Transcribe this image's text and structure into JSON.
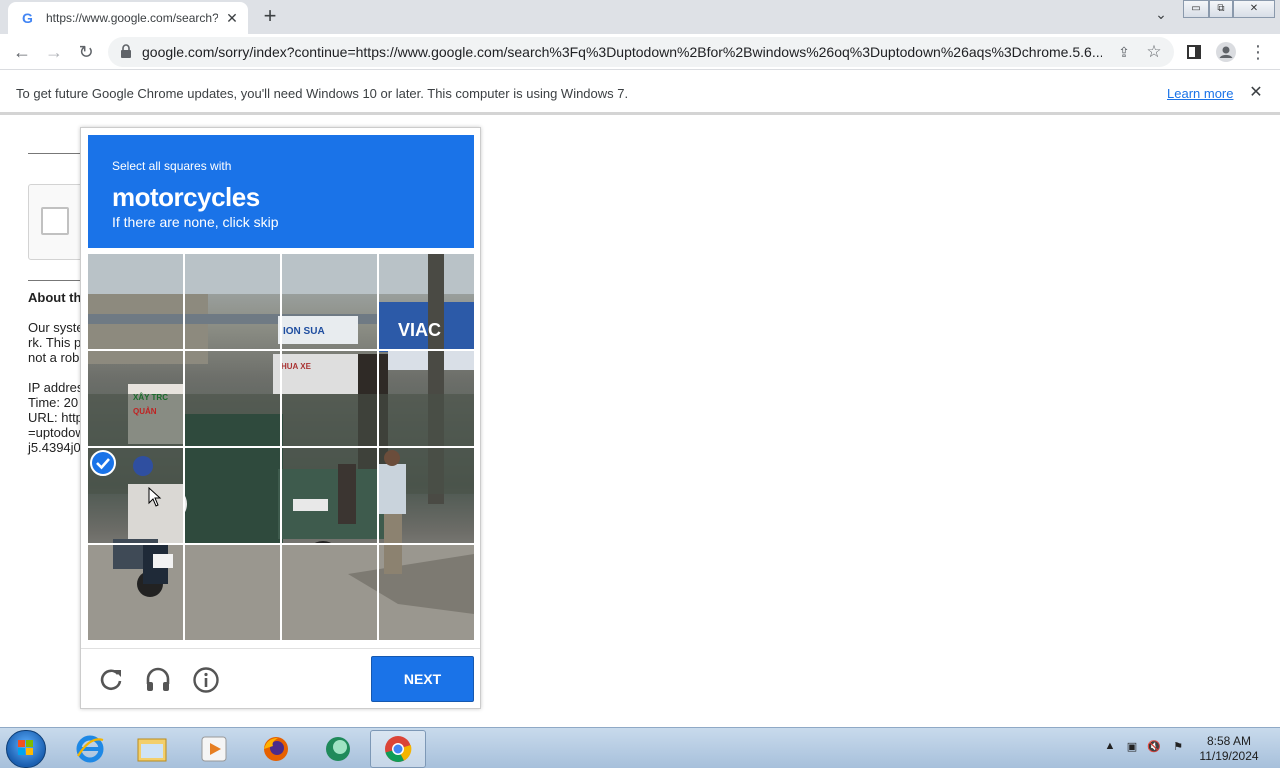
{
  "browser": {
    "tab": {
      "title": "https://www.google.com/search?q",
      "favicon": "google-g-icon"
    },
    "url": "google.com/sorry/index?continue=https://www.google.com/search%3Fq%3Duptodown%2Bfor%2Bwindows%26oq%3Duptodown%26aqs%3Dchrome.5.6...",
    "window_controls": [
      "minimize",
      "restore",
      "close"
    ]
  },
  "infobar": {
    "message": "To get future Google Chrome updates, you'll need Windows 10 or later. This computer is using Windows 7.",
    "link": "Learn more"
  },
  "page": {
    "about_heading": "About th",
    "para1": [
      "Our syste",
      "rk. This p",
      "not a rob"
    ],
    "para2": [
      "IP addres",
      "Time: 20",
      "URL: http",
      "=uptodow",
      "j5.4394j0"
    ]
  },
  "captcha": {
    "instruction": "Select all squares with",
    "target": "motorcycles",
    "hint": "If there are none, click skip",
    "grid": {
      "rows": 4,
      "cols": 4,
      "selected": [
        [
          2,
          0
        ]
      ]
    },
    "sign_texts": [
      "ION SUA",
      "VIAC",
      "HUA XE",
      "XÂY TRC",
      "QUẢN"
    ],
    "next_label": "NEXT",
    "footer_icons": [
      "reload-icon",
      "audio-icon",
      "info-icon"
    ],
    "accent_color": "#1a73e8"
  },
  "taskbar": {
    "apps": [
      "internet-explorer-icon",
      "file-explorer-icon",
      "media-player-icon",
      "firefox-icon",
      "app-icon",
      "chrome-icon"
    ],
    "clock": {
      "time": "8:58 AM",
      "date": "11/19/2024"
    }
  }
}
